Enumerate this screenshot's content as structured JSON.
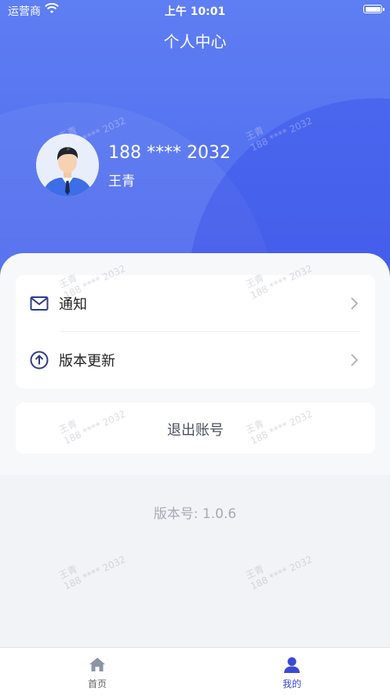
{
  "status_bar": {
    "carrier": "运营商",
    "time": "上午 10:01"
  },
  "header": {
    "title": "个人中心"
  },
  "user": {
    "phone": "188 **** 2032",
    "name": "王青"
  },
  "menu": [
    {
      "label": "通知",
      "icon": "mail-icon"
    },
    {
      "label": "版本更新",
      "icon": "upload-arrow-icon"
    }
  ],
  "logout_label": "退出账号",
  "version_text": "版本号: 1.0.6",
  "tabbar": {
    "items": [
      {
        "label": "首页",
        "icon": "home-icon",
        "active": false
      },
      {
        "label": "我的",
        "icon": "user-icon",
        "active": true
      }
    ]
  },
  "watermark": {
    "name": "王青",
    "phone": "188 **** 2032"
  },
  "colors": {
    "primary": "#5573f0",
    "tab_active": "#3a48d6",
    "tab_inactive": "#666666"
  }
}
